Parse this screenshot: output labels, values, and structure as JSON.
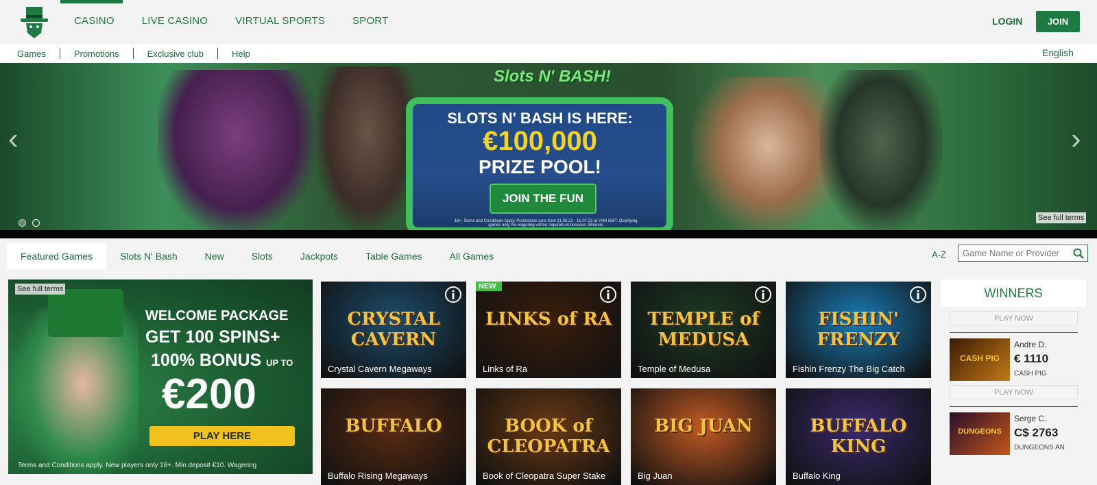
{
  "header": {
    "nav": [
      "CASINO",
      "LIVE CASINO",
      "VIRTUAL SPORTS",
      "SPORT"
    ],
    "login": "LOGIN",
    "join": "JOIN"
  },
  "subnav": {
    "items": [
      "Games",
      "Promotions",
      "Exclusive club",
      "Help"
    ],
    "language": "English"
  },
  "banner": {
    "logo": "Slots N' BASH!",
    "line1": "SLOTS N' BASH IS HERE:",
    "line2": "€100,000",
    "line3": "PRIZE POOL!",
    "cta": "JOIN THE FUN",
    "fine_print": "18+. Terms and Conditions Apply. Promotions runs from 21.06.22 - 15.07.22 at 7AM GMT. Qualifying games only. No wagering will be required on bonuses. Winners",
    "terms": "See full terms",
    "arrow_left": "‹",
    "arrow_right": "›"
  },
  "tabs": {
    "items": [
      "Featured Games",
      "Slots N' Bash",
      "New",
      "Slots",
      "Jackpots",
      "Table Games",
      "All Games"
    ],
    "active": "Featured Games",
    "az": "A-Z",
    "search_placeholder": "Game Name or Provider"
  },
  "welcome": {
    "terms": "See full terms",
    "line1": "WELCOME PACKAGE",
    "line2": "GET 100 SPINS+",
    "line3": "100% BONUS",
    "line3_small": "UP TO",
    "line4": "€200",
    "cta": "PLAY HERE",
    "fine": "Terms and Conditions apply. New players only 18+. Min deposit €10. Wagering"
  },
  "games": [
    {
      "title": "Crystal Cavern Megaways",
      "logo": "CRYSTAL CAVERN",
      "new": false,
      "bg": "#1d4d6e"
    },
    {
      "title": "Links of Ra",
      "logo": "LINKS of RA",
      "new": true,
      "new_label": "NEW",
      "bg": "#3b1e0c"
    },
    {
      "title": "Temple of Medusa",
      "logo": "TEMPLE of MEDUSA",
      "new": false,
      "bg": "#1d3a25"
    },
    {
      "title": "Fishin Frenzy The Big Catch",
      "logo": "FISHIN' FRENZY",
      "new": false,
      "bg": "#1a7cb8"
    },
    {
      "title": "Buffalo Rising Megaways",
      "logo": "BUFFALO",
      "new": false,
      "bg": "#5b2b12"
    },
    {
      "title": "Book of Cleopatra Super Stake",
      "logo": "BOOK of CLEOPATRA",
      "new": false,
      "bg": "#6a3a14"
    },
    {
      "title": "Big Juan",
      "logo": "BIG JUAN",
      "new": false,
      "bg": "#c25a23"
    },
    {
      "title": "Buffalo King",
      "logo": "BUFFALO KING",
      "new": false,
      "bg": "#3a2a6e"
    }
  ],
  "winners": {
    "title": "WINNERS",
    "play_now": "PLAY NOW",
    "entries": [
      {
        "name": "Andre D.",
        "amount": "€ 1110",
        "game": "CASH PIG",
        "thumb_text": "CASH PIG"
      },
      {
        "name": "Serge C.",
        "amount": "C$ 2763",
        "game": "DUNGEONS AN",
        "thumb_text": "DUNGEONS"
      }
    ]
  },
  "colors": {
    "brand": "#1e7a43",
    "accent": "#f1c21e"
  }
}
